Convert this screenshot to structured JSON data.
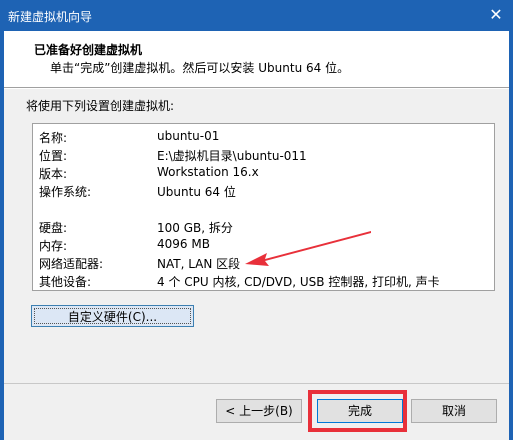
{
  "window": {
    "title": "新建虚拟机向导",
    "close_glyph": "✕"
  },
  "header": {
    "title": "已准备好创建虚拟机",
    "subtitle": "单击“完成”创建虚拟机。然后可以安装 Ubuntu 64 位。"
  },
  "intro": "将使用下列设置创建虚拟机:",
  "summary": {
    "rows": [
      {
        "key": "名称:",
        "value": "ubuntu-01"
      },
      {
        "key": "位置:",
        "value": "E:\\虚拟机目录\\ubuntu-011"
      },
      {
        "key": "版本:",
        "value": "Workstation 16.x"
      },
      {
        "key": "操作系统:",
        "value": "Ubuntu 64 位"
      },
      {
        "key": "硬盘:",
        "value": "100 GB, 拆分"
      },
      {
        "key": "内存:",
        "value": "4096 MB"
      },
      {
        "key": "网络适配器:",
        "value": "NAT, LAN 区段"
      },
      {
        "key": "其他设备:",
        "value": "4 个 CPU 内核, CD/DVD, USB 控制器, 打印机, 声卡"
      }
    ]
  },
  "buttons": {
    "customize": "自定义硬件(C)...",
    "back": "< 上一步(B)",
    "finish": "完成",
    "cancel": "取消"
  },
  "colors": {
    "titlebar": "#1e63b4",
    "annotation_red": "#e8303a"
  }
}
